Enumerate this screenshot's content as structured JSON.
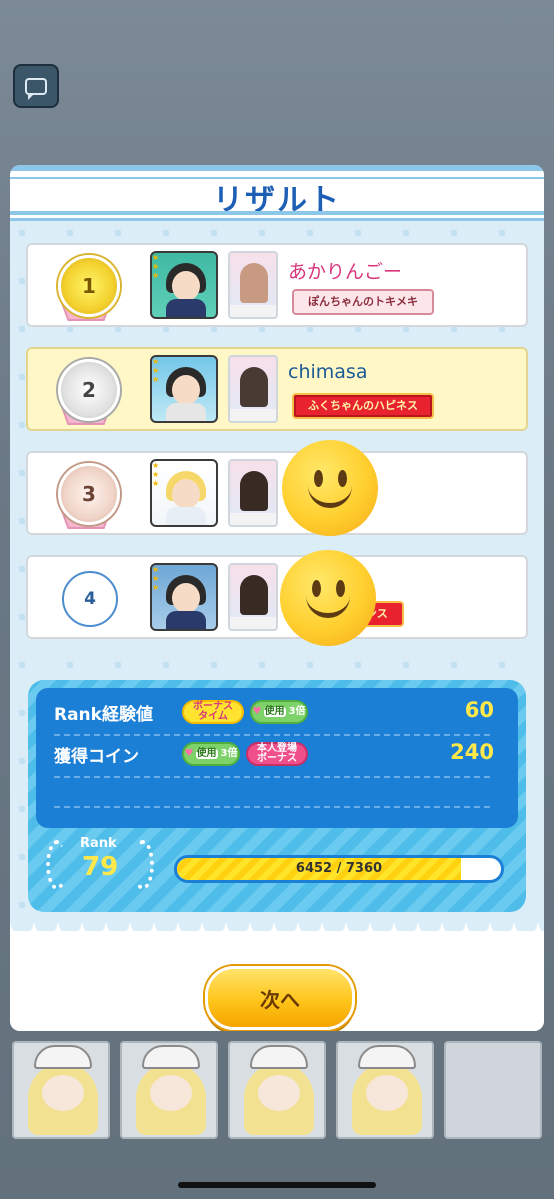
{
  "header": {
    "chat_icon": "speech-bubble-icon"
  },
  "result": {
    "title": "リザルト",
    "players": [
      {
        "rank": "1",
        "name": "あかりんごー",
        "title": "ぽんちゃんのトキメキ",
        "avatar_tag": "Akari"
      },
      {
        "rank": "2",
        "name": "chimasa",
        "title": "ふくちゃんのハピネス",
        "avatar_tag": "EU"
      },
      {
        "rank": "3",
        "name": "",
        "title": ""
      },
      {
        "rank": "4",
        "name": "",
        "title": "ロマンス",
        "avatar_tag": "MAI"
      }
    ]
  },
  "rewards": {
    "rank_exp_label": "Rank経験値",
    "bonus_time": "ボーナス\nタイム",
    "use_label": "使用",
    "multiplier": "3倍",
    "rank_exp_value": "60",
    "coin_label": "獲得コイン",
    "coin_value": "240",
    "self_bonus": "本人登場\nボーナス"
  },
  "rank": {
    "label": "Rank",
    "level": "79",
    "progress_text": "6452 / 7360",
    "progress_current": 6452,
    "progress_max": 7360
  },
  "next_button": "次へ",
  "colors": {
    "accent": "#1d5fb5",
    "panel": "#1c7fd6",
    "gold": "#ffe94a"
  }
}
